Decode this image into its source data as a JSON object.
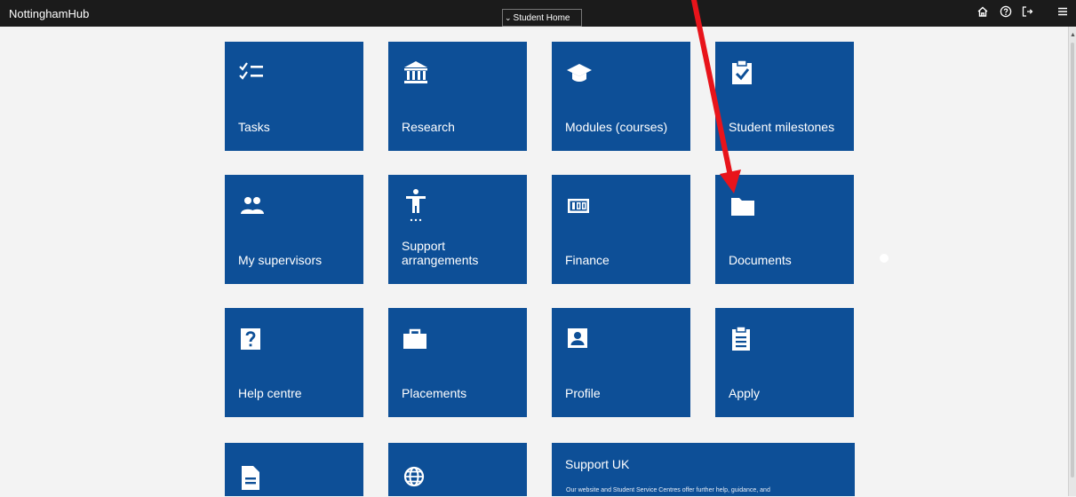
{
  "header": {
    "brand": "NottinghamHub",
    "page_selector": "Student Home",
    "icons": [
      "home-icon",
      "help-icon",
      "sign-out-icon",
      "menu-icon"
    ]
  },
  "tiles": [
    {
      "label": "Tasks",
      "icon": "tasks-checklist-icon"
    },
    {
      "label": "Research",
      "icon": "institution-icon"
    },
    {
      "label": "Modules (courses)",
      "icon": "graduation-cap-icon"
    },
    {
      "label": "Student milestones",
      "icon": "clipboard-check-icon"
    },
    {
      "label": "My supervisors",
      "icon": "people-icon"
    },
    {
      "label_line1": "Support",
      "label_line2": "arrangements",
      "icon": "accessibility-icon"
    },
    {
      "label": "Finance",
      "icon": "finance-counter-icon"
    },
    {
      "label": "Documents",
      "icon": "folder-icon"
    },
    {
      "label": "Help centre",
      "icon": "question-icon"
    },
    {
      "label": "Placements",
      "icon": "briefcase-icon"
    },
    {
      "label": "Profile",
      "icon": "profile-card-icon"
    },
    {
      "label": "Apply",
      "icon": "clipboard-list-icon"
    },
    {
      "label": "",
      "icon": "document-icon"
    },
    {
      "label": "",
      "icon": "globe-icon"
    }
  ],
  "support_tile": {
    "title": "Support UK",
    "text": "Our website and Student Service Centres offer further help, guidance, and"
  },
  "colors": {
    "topbar": "#1b1b1b",
    "tile": "#0d4f97",
    "background": "#f3f3f3",
    "annotation_arrow": "#e8141b"
  }
}
